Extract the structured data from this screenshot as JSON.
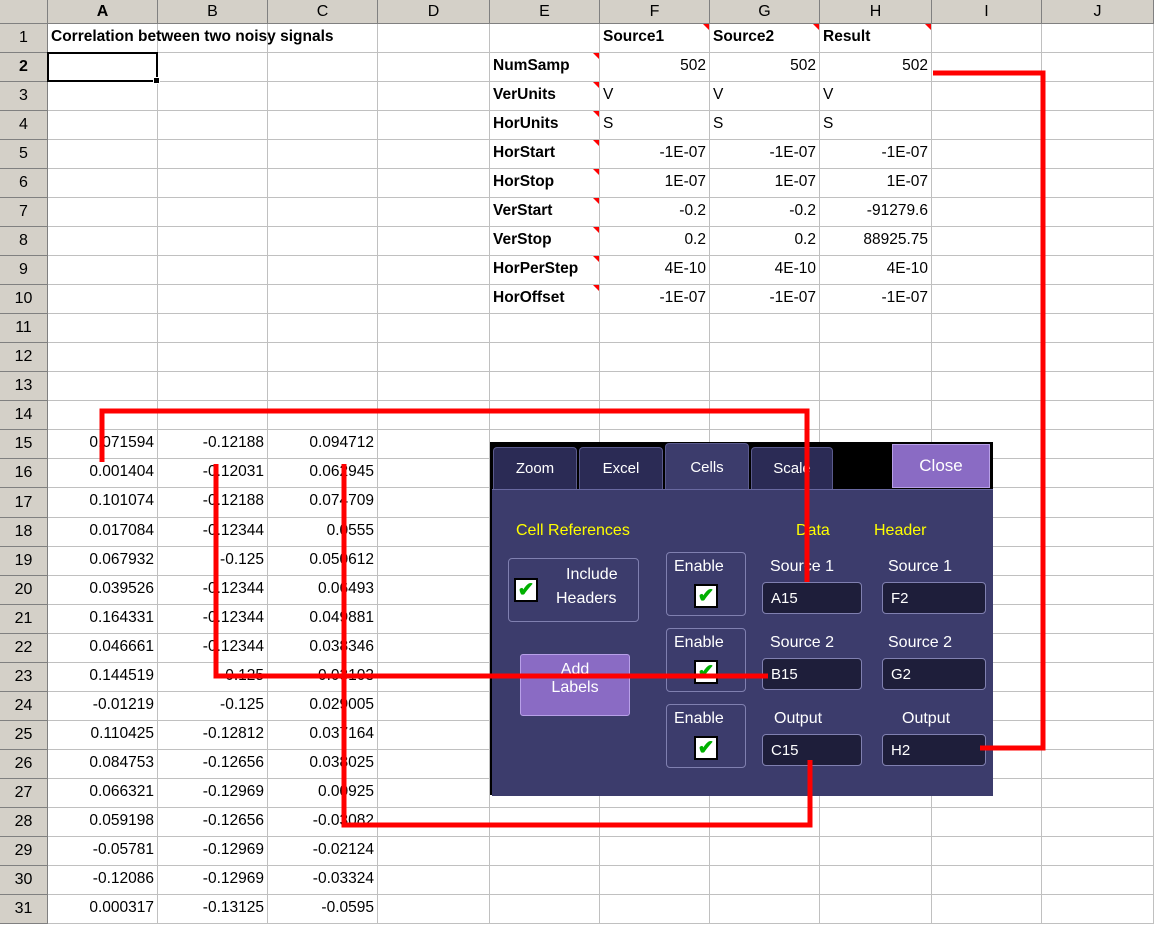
{
  "columns": [
    "A",
    "B",
    "C",
    "D",
    "E",
    "F",
    "G",
    "H",
    "I",
    "J"
  ],
  "rows": [
    "1",
    "2",
    "3",
    "4",
    "5",
    "6",
    "7",
    "8",
    "9",
    "10",
    "11",
    "12",
    "13",
    "14",
    "15",
    "16",
    "17",
    "18",
    "19",
    "20",
    "21",
    "22",
    "23",
    "24",
    "25",
    "26",
    "27",
    "28",
    "29",
    "30",
    "31"
  ],
  "title": "Correlation between two noisy signals",
  "table_header": {
    "source1": "Source1",
    "source2": "Source2",
    "result": "Result"
  },
  "params": [
    {
      "name": "NumSamp",
      "f": "502",
      "g": "502",
      "h": "502"
    },
    {
      "name": "VerUnits",
      "f": "V",
      "g": "V",
      "h": "V"
    },
    {
      "name": "HorUnits",
      "f": "S",
      "g": "S",
      "h": "S"
    },
    {
      "name": "HorStart",
      "f": "-1E-07",
      "g": "-1E-07",
      "h": "-1E-07"
    },
    {
      "name": "HorStop",
      "f": "1E-07",
      "g": "1E-07",
      "h": "1E-07"
    },
    {
      "name": "VerStart",
      "f": "-0.2",
      "g": "-0.2",
      "h": "-91279.6"
    },
    {
      "name": "VerStop",
      "f": "0.2",
      "g": "0.2",
      "h": "88925.75"
    },
    {
      "name": "HorPerStep",
      "f": "4E-10",
      "g": "4E-10",
      "h": "4E-10"
    },
    {
      "name": "HorOffset",
      "f": "-1E-07",
      "g": "-1E-07",
      "h": "-1E-07"
    }
  ],
  "data_rows": [
    [
      "0.071594",
      "-0.12188",
      "0.094712"
    ],
    [
      "0.001404",
      "-0.12031",
      "0.062945"
    ],
    [
      "0.101074",
      "-0.12188",
      "0.074709"
    ],
    [
      "0.017084",
      "-0.12344",
      "0.0555"
    ],
    [
      "0.067932",
      "-0.125",
      "0.050612"
    ],
    [
      "0.039526",
      "-0.12344",
      "0.06493"
    ],
    [
      "0.164331",
      "-0.12344",
      "0.049881"
    ],
    [
      "0.046661",
      "-0.12344",
      "0.038346"
    ],
    [
      "0.144519",
      "-0.125",
      "0.03103"
    ],
    [
      "-0.01219",
      "-0.125",
      "0.029005"
    ],
    [
      "0.110425",
      "-0.12812",
      "0.037164"
    ],
    [
      "0.084753",
      "-0.12656",
      "0.038025"
    ],
    [
      "0.066321",
      "-0.12969",
      "0.00925"
    ],
    [
      "0.059198",
      "-0.12656",
      "-0.03082"
    ],
    [
      "-0.05781",
      "-0.12969",
      "-0.02124"
    ],
    [
      "-0.12086",
      "-0.12969",
      "-0.03324"
    ],
    [
      "0.000317",
      "-0.13125",
      "-0.0595"
    ]
  ],
  "dialog": {
    "tabs": [
      "Zoom",
      "Excel",
      "Cells",
      "Scale"
    ],
    "close": "Close",
    "cell_refs": "Cell References",
    "data": "Data",
    "header": "Header",
    "include": "Include",
    "headers": "Headers",
    "add": "Add",
    "labels": "Labels",
    "enable": "Enable",
    "source1_label": "Source 1",
    "source2_label": "Source 2",
    "output_label": "Output",
    "source1_data": "A15",
    "source1_header": "F2",
    "source2_data": "B15",
    "source2_header": "G2",
    "output_data": "C15",
    "output_header": "H2"
  }
}
